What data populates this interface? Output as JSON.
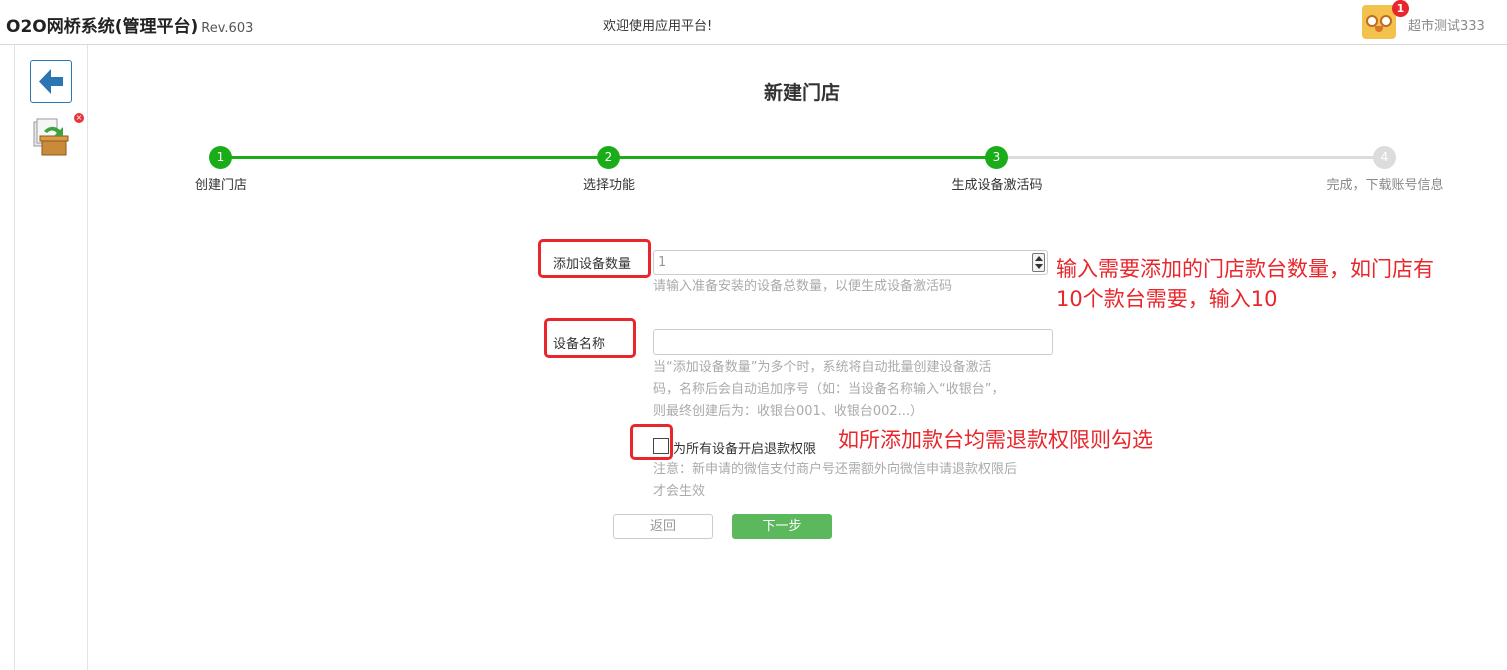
{
  "header": {
    "brand": "O2O网桥系统(管理平台)",
    "rev": "Rev.603",
    "welcome": "欢迎使用应用平台!",
    "notification_count": "1",
    "username": "超市测试333"
  },
  "sidebar": {
    "back_icon": "arrow-left-icon",
    "app_icon": "box-refresh-icon",
    "close_glyph": "×"
  },
  "page": {
    "title": "新建门店"
  },
  "steps": [
    {
      "num": "1",
      "label": "创建门店",
      "status": "done"
    },
    {
      "num": "2",
      "label": "选择功能",
      "status": "done"
    },
    {
      "num": "3",
      "label": "生成设备激活码",
      "status": "done"
    },
    {
      "num": "4",
      "label": "完成，下载账号信息",
      "status": "todo"
    }
  ],
  "form": {
    "device_count": {
      "label": "添加设备数量",
      "value": "1",
      "help": "请输入准备安装的设备总数量，以便生成设备激活码"
    },
    "device_name": {
      "label": "设备名称",
      "value": "",
      "help": [
        "当“添加设备数量”为多个时，系统将自动批量创建设备激活",
        "码，名称后会自动追加序号（如：当设备名称输入“收银台”，",
        "则最终创建后为：收银台001、收银台002...）"
      ]
    },
    "refund": {
      "label": "为所有设备开启退款权限",
      "checked": false,
      "help": [
        "注意：新申请的微信支付商户号还需额外向微信申请退款权限后",
        "才会生效"
      ]
    },
    "back_button": "返回",
    "next_button": "下一步"
  },
  "annotations": {
    "count_note": [
      "输入需要添加的门店款台数量，如门店有",
      "10个款台需要，输入10"
    ],
    "refund_note": "如所添加款台均需退款权限则勾选"
  },
  "colors": {
    "step_done": "#1aad19",
    "step_todo": "#dcdcdc",
    "primary_button": "#5cb85c",
    "annotation_red": "#e8262b",
    "back_icon_blue": "#2c75b5"
  }
}
